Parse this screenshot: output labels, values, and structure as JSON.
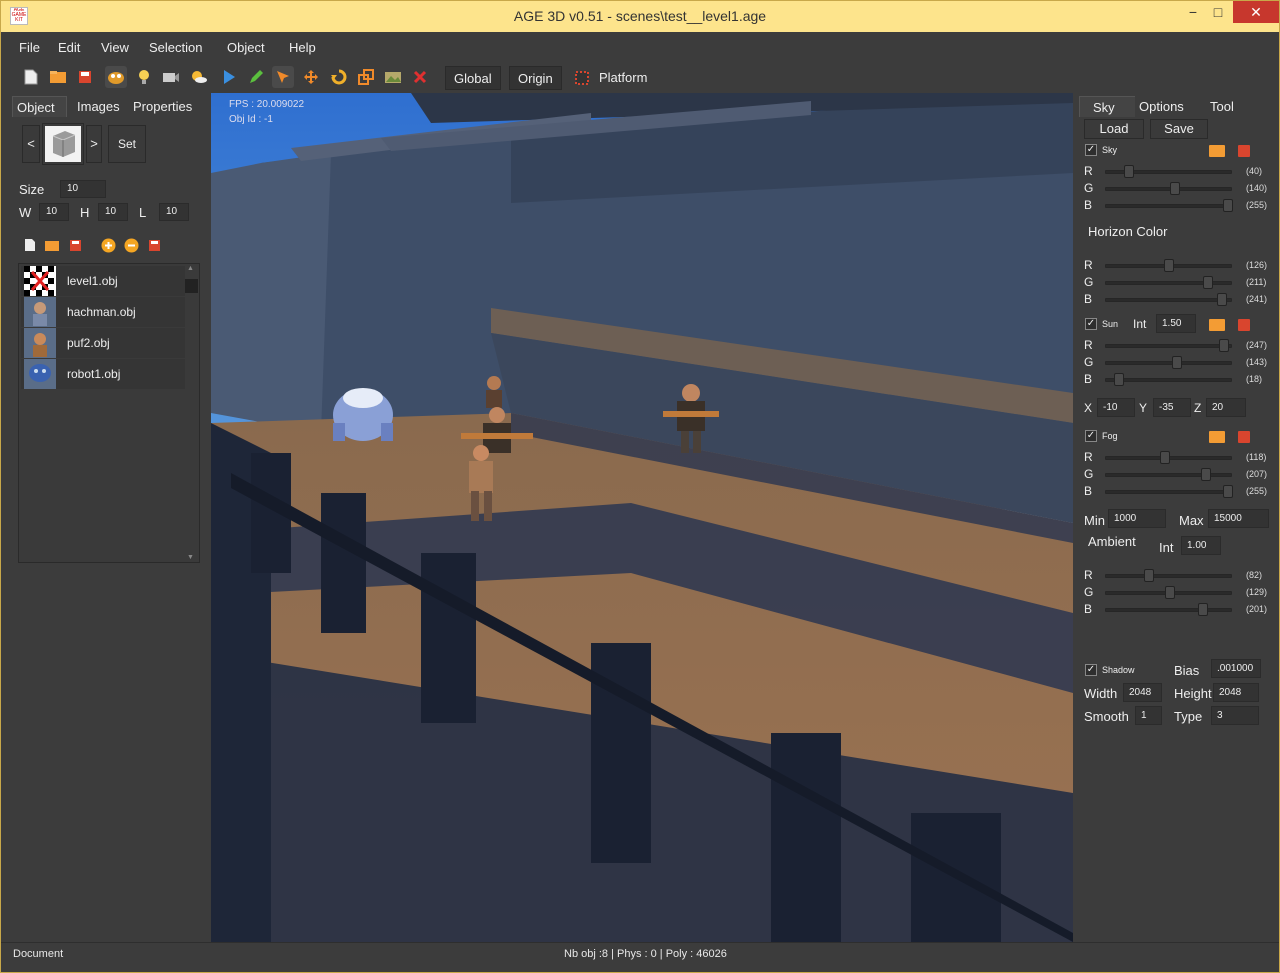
{
  "window": {
    "title": "AGE 3D v0.51 - scenes\\test__level1.age",
    "min": "−",
    "max": "□",
    "close": "✕",
    "app_icon": "Age Game Kit"
  },
  "menu": [
    "File",
    "Edit",
    "View",
    "Selection",
    "Object",
    "Help"
  ],
  "toolbar": {
    "icons": [
      "new-file-icon",
      "open-folder-icon",
      "save-icon",
      "monster-icon",
      "light-bulb-icon",
      "camera-icon",
      "sun-cloud-icon",
      "play-icon",
      "pencil-icon",
      "select-arrow-icon",
      "move-icon",
      "rotate-icon",
      "scale-icon",
      "terrain-icon",
      "delete-icon"
    ],
    "global": "Global",
    "origin": "Origin",
    "platform": "Platform"
  },
  "left": {
    "tabs": [
      "Object",
      "Images",
      "Properties"
    ],
    "prev": "<",
    "next": ">",
    "set": "Set",
    "size_label": "Size",
    "size": "10",
    "w_label": "W",
    "w": "10",
    "h_label": "H",
    "h": "10",
    "l_label": "L",
    "l": "10",
    "files": [
      "level1.obj",
      "hachman.obj",
      "puf2.obj",
      "robot1.obj"
    ],
    "scroll_up": "▲",
    "scroll_down": "▼"
  },
  "viewport": {
    "fps": "FPS : 20.009022",
    "objid": "Obj Id : -1"
  },
  "right": {
    "tabs": [
      "Sky",
      "Options",
      "Tool"
    ],
    "load": "Load",
    "save": "Save",
    "sky": {
      "label": "Sky",
      "r": "(40)",
      "g": "(140)",
      "b": "(255)",
      "rv": 40,
      "gv": 140,
      "bv": 255
    },
    "horizon": {
      "label": "Horizon Color",
      "r": "(126)",
      "g": "(211)",
      "b": "(241)",
      "rv": 126,
      "gv": 211,
      "bv": 241
    },
    "sun": {
      "label": "Sun",
      "int_label": "Int",
      "int": "1.50",
      "r": "(247)",
      "g": "(143)",
      "b": "(18)",
      "rv": 247,
      "gv": 143,
      "bv": 18
    },
    "pos": {
      "x_label": "X",
      "x": "-10",
      "y_label": "Y",
      "y": "-35",
      "z_label": "Z",
      "z": "20"
    },
    "fog": {
      "label": "Fog",
      "r": "(118)",
      "g": "(207)",
      "b": "(255)",
      "rv": 118,
      "gv": 207,
      "bv": 255
    },
    "fogrange": {
      "min_label": "Min",
      "min": "1000",
      "max_label": "Max",
      "max": "15000"
    },
    "ambient": {
      "label": "Ambient",
      "int_label": "Int",
      "int": "1.00",
      "r": "(82)",
      "g": "(129)",
      "b": "(201)",
      "rv": 82,
      "gv": 129,
      "bv": 201
    },
    "shadow": {
      "label": "Shadow",
      "bias_label": "Bias",
      "bias": ".001000",
      "width_label": "Width",
      "width": "2048",
      "height_label": "Height",
      "height": "2048",
      "smooth_label": "Smooth",
      "smooth": "1",
      "type_label": "Type",
      "type": "3"
    },
    "channels": [
      "R",
      "G",
      "B"
    ],
    "check": "✓"
  },
  "status": {
    "left": "Document",
    "center": "Nb obj :8 | Phys : 0 | Poly : 46026"
  }
}
